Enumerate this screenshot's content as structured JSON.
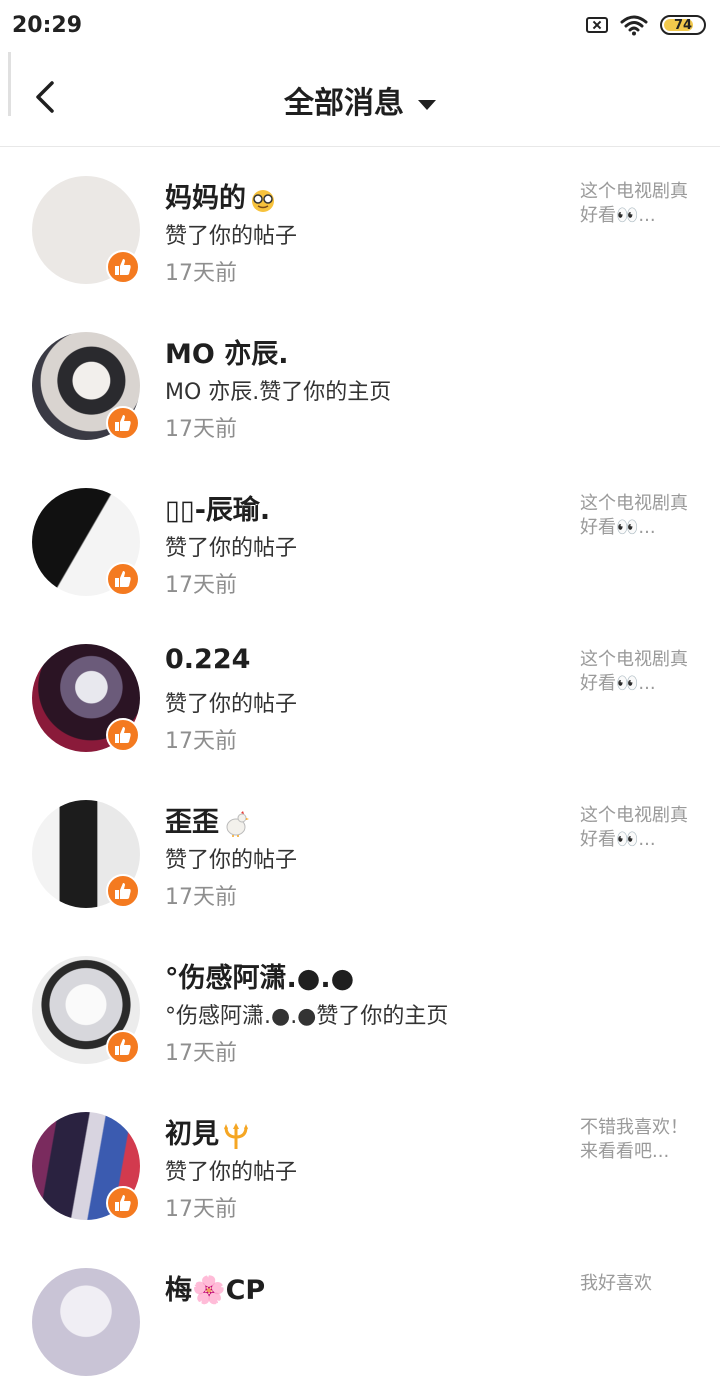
{
  "status_bar": {
    "time": "20:29",
    "battery": "74"
  },
  "header": {
    "title": "全部消息"
  },
  "notifications": [
    {
      "name": "妈妈的",
      "action": "赞了你的帖子",
      "time": "17天前",
      "preview": "这个电视剧真好看👀..."
    },
    {
      "name": "MO  亦辰.",
      "action": "MO  亦辰.赞了你的主页",
      "time": "17天前",
      "preview": ""
    },
    {
      "name": "▯▯-辰瑜.",
      "action": "赞了你的帖子",
      "time": "17天前",
      "preview": "这个电视剧真好看👀..."
    },
    {
      "name": "0.224",
      "action": "赞了你的帖子",
      "time": "17天前",
      "preview": "这个电视剧真好看👀..."
    },
    {
      "name": "歪歪",
      "action": "赞了你的帖子",
      "time": "17天前",
      "preview": "这个电视剧真好看👀..."
    },
    {
      "name": "°伤感阿潇.●.●",
      "action": "°伤感阿潇.●.●赞了你的主页",
      "time": "17天前",
      "preview": ""
    },
    {
      "name": "初見",
      "action": "赞了你的帖子",
      "time": "17天前",
      "preview": "不错我喜欢！来看看吧..."
    },
    {
      "name": "梅🌸CP",
      "action": "",
      "time": "",
      "preview": "我好喜欢"
    }
  ]
}
